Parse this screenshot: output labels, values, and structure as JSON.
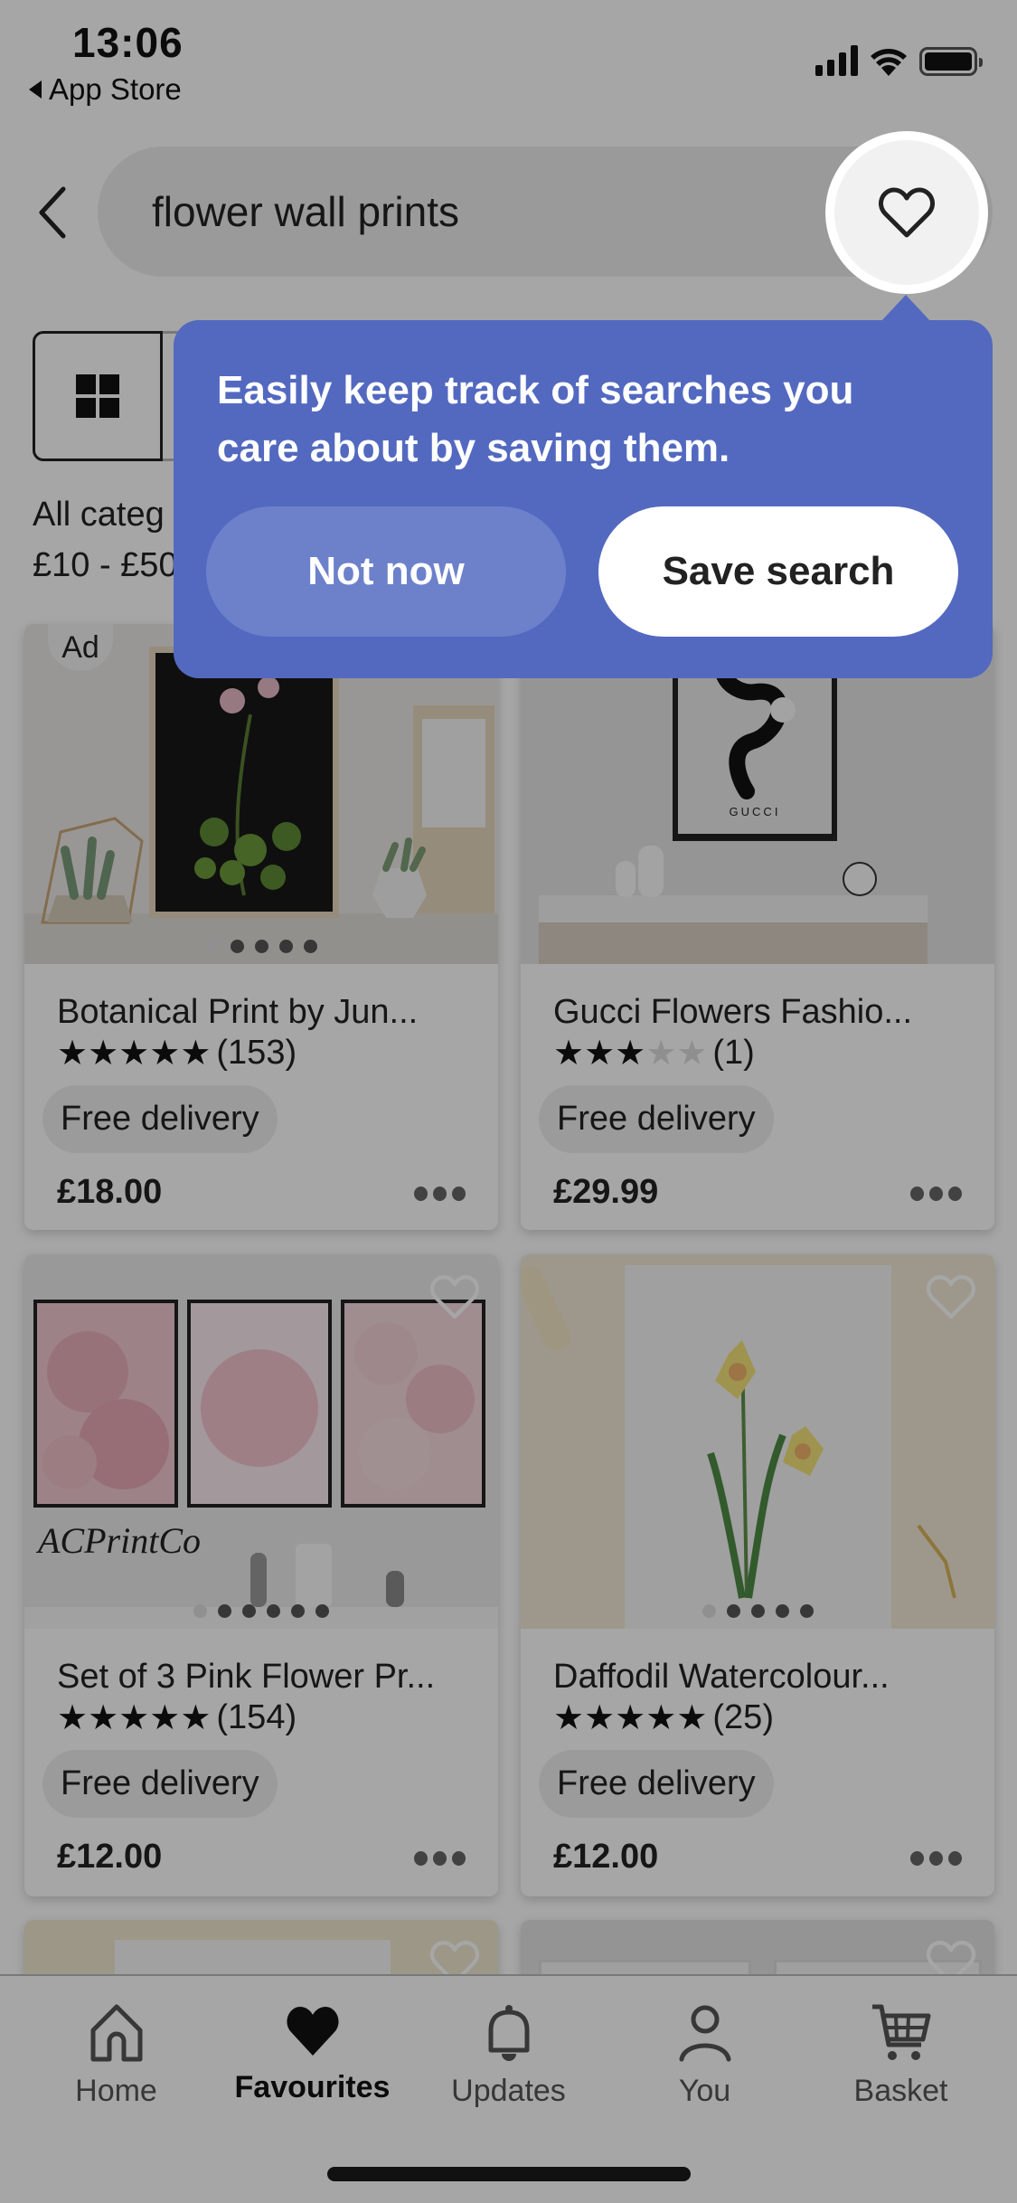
{
  "status_bar": {
    "time": "13:06",
    "back_app": "App Store",
    "icons": [
      "signal-icon",
      "wifi-icon",
      "battery-icon"
    ]
  },
  "search": {
    "query": "flower wall prints",
    "back_icon": "chevron-left-icon",
    "save_icon": "heart-outline-icon"
  },
  "filters": {
    "view_icon": "grid-view-icon",
    "category": "All categ",
    "price_range": "£10 - £50"
  },
  "tooltip": {
    "message": "Easily keep track of searches you care about by saving them.",
    "dismiss_label": "Not now",
    "confirm_label": "Save search",
    "color": "#5369c0"
  },
  "products": [
    {
      "title": "Botanical Print by Jun...",
      "rating": 5,
      "reviews": "(153)",
      "badge": "Free delivery",
      "price": "£18.00",
      "ad": "Ad",
      "images": 5,
      "active_image": 0
    },
    {
      "title": "Gucci Flowers Fashio...",
      "rating": 3,
      "reviews": "(1)",
      "badge": "Free delivery",
      "price": "£29.99",
      "image_caption": "GUCCI"
    },
    {
      "title": "Set of 3 Pink Flower Pr...",
      "rating": 5,
      "reviews": "(154)",
      "badge": "Free delivery",
      "price": "£12.00",
      "image_caption": "ACPrintCo",
      "images": 6,
      "active_image": 0
    },
    {
      "title": "Daffodil Watercolour...",
      "rating": 5,
      "reviews": "(25)",
      "badge": "Free delivery",
      "price": "£12.00",
      "images": 5,
      "active_image": 0
    }
  ],
  "bottom_nav": {
    "items": [
      {
        "label": "Home",
        "icon": "home-icon",
        "active": false
      },
      {
        "label": "Favourites",
        "icon": "heart-filled-icon",
        "active": true
      },
      {
        "label": "Updates",
        "icon": "bell-icon",
        "active": false
      },
      {
        "label": "You",
        "icon": "person-icon",
        "active": false
      },
      {
        "label": "Basket",
        "icon": "cart-icon",
        "active": false
      }
    ]
  }
}
